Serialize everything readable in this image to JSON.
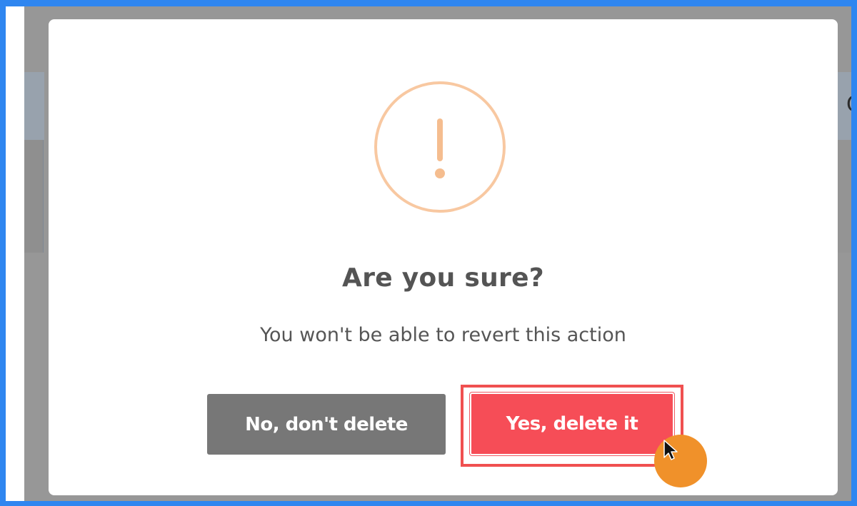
{
  "background": {
    "partial_header_text": "C"
  },
  "dialog": {
    "title": "Are you sure?",
    "message": "You won't be able to revert this action",
    "cancel_label": "No, don't delete",
    "confirm_label": "Yes, delete it",
    "icon": "warning-exclamation-icon"
  },
  "colors": {
    "frame_border": "#2f86f0",
    "overlay": "#979797",
    "warning_icon": "#f8c8a1",
    "cancel_button": "#777777",
    "confirm_button": "#f64d57",
    "highlight_outline": "#f05050",
    "cursor_marker": "#f0912a"
  }
}
